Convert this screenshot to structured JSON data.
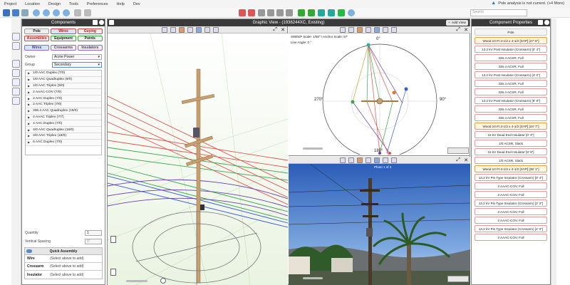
{
  "menu": [
    "Project",
    "Location",
    "Design",
    "Tools",
    "Preferences",
    "Help",
    "Dev"
  ],
  "alert": {
    "text": "Pole analysis is not current. (+4 More)"
  },
  "search": {
    "placeholder": "Search"
  },
  "components_panel": {
    "title": "Components",
    "tabs_row1": [
      "Pole",
      "Wires",
      "Guying"
    ],
    "tabs_row2": [
      "Assemblies",
      "Equipment",
      "Points"
    ],
    "tabs_row3": [
      "Wires",
      "Crossarms",
      "Insulators"
    ],
    "owner_label": "Owner",
    "owner_value": "Acme Power",
    "group_label": "Group",
    "group_value": "Secondary",
    "wire_list": [
      "1/0 AAC Duplex (7/0)",
      "1/0 AAC Quadruplex (9/0)",
      "1/0 AAC Triplex (9/0)",
      "2 AAAC-COV (7/0)",
      "2 AAC Duplex (7/0)",
      "2 AAC Triplex (7/0)",
      "336.4 AAC Quadruplex (19/0)",
      "4 AAAC Triplex (7/7)",
      "4 AAC Duplex (7/0)",
      "4/0 AAC Quadruplex (18/0)",
      "4/0 AAC Triplex (18/0)",
      "6 AAC Duplex (7/0)"
    ],
    "quantity_label": "Quantity",
    "quantity_value": "1",
    "spacing_label": "Vertical Spacing",
    "spacing_value": "0\"",
    "quick_assembly": {
      "title": "Quick Assembly",
      "rows": [
        {
          "k": "Wire",
          "v": "(Select above to add)"
        },
        {
          "k": "Crossarm",
          "v": "(Select above to add)"
        },
        {
          "k": "Insulator",
          "v": "(Select above to add)"
        }
      ]
    }
  },
  "graphic_view": {
    "title": "Graphic View - (1936244XC, Existing)",
    "add_view": "Add View",
    "sweep_scale": "SWEEP Scale: 1/68\" / Anchor Scale: 57'",
    "line_angle": "Line Angle: 0 °",
    "compass": {
      "top": "0°",
      "left": "270°",
      "right": "90°",
      "bottom": "180°"
    },
    "photo_label": "Photo 1 of 3"
  },
  "component_properties": {
    "title": "Component Properties",
    "items": [
      "Pole",
      "Wood 10 Ft 3-1/2 x 4-1/2 [SYP] [47' 8\"]",
      "13.2 kV Post Insulator (Crossarm) [0' 4\"]",
      "336.4 ACSR, Full",
      "336.4 ACSR, Full",
      "13.2 kV Post Insulator (Crossarm) [4' 0\"]",
      "336.4 ACSR, Full",
      "336.4 ACSR, Full",
      "13.2 kV Post Insulator (Crossarm) [9' 8\"]",
      "336.4 ACSR, Full",
      "336.4 ACSR, Full",
      "Wood 10 Ft 3-1/2 x 4-1/2 [SYP] [44' 7\"]",
      "15 kV Dead End Insulator [0' 4\"]",
      "1/0 ACSR, Slack",
      "15 kV Dead End Insulator [8' 8\"]",
      "1/0 ACSR, Slack",
      "Wood 10 Ft 3-1/2 x 4-1/2 [SYP] [39' 1\"]",
      "13.2 kV Pin Type Insulator (Crossarm) [0' 4\"]",
      "2 AAAC-COV, Full",
      "2 AAAC-COV, Full",
      "13.2 kV Pin Type Insulator (Crossarm) [2' 2\"]",
      "2 AAAC-COV, Full",
      "2 AAAC-COV, Full",
      "13.2 kV Pin Type Insulator (Crossarm) [4' 0\"]",
      "2 AAAC-COV, Full"
    ],
    "selected_indices": [
      1,
      11,
      16
    ]
  },
  "colors": {
    "wire_red": "#e0524a",
    "wire_green": "#3aa84a",
    "wire_purple": "#6a3fb3",
    "wire_blue": "#3b5bd6",
    "pole_brown": "#c8a070",
    "panel_header": "#3a3a3a"
  }
}
